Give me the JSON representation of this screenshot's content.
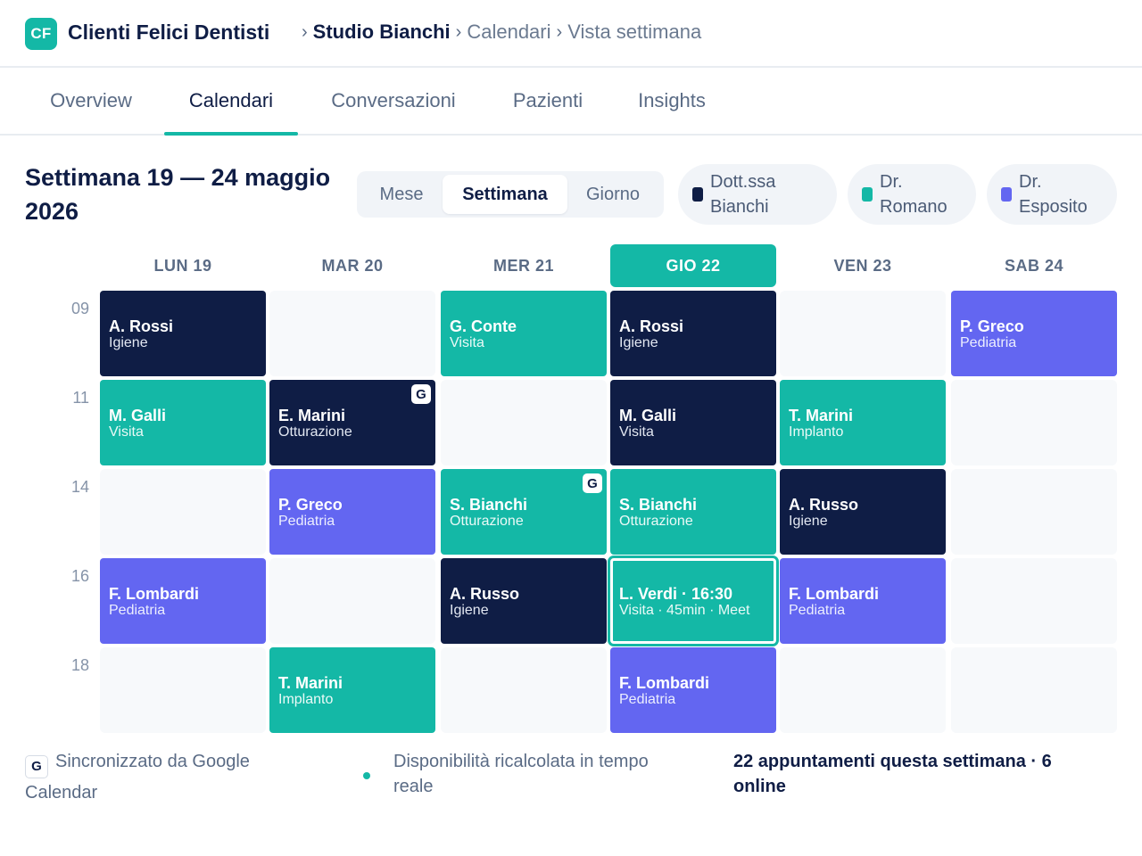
{
  "header": {
    "logo_text": "CF",
    "brand": "Clienti Felici Dentisti",
    "breadcrumb": [
      "Studio Bianchi",
      "Calendari",
      "Vista settimana"
    ]
  },
  "tabs": [
    "Overview",
    "Calendari",
    "Conversazioni",
    "Pazienti",
    "Insights"
  ],
  "active_tab": "Calendari",
  "toolbar": {
    "week_title": "Settimana 19 — 24 maggio 2026",
    "view_options": [
      "Mese",
      "Settimana",
      "Giorno"
    ],
    "active_view": "Settimana",
    "doctors": [
      {
        "label": "Dott.ssa Bianchi",
        "color": "#0f1d45"
      },
      {
        "label": "Dr. Romano",
        "color": "#14b8a6"
      },
      {
        "label": "Dr. Esposito",
        "color": "#6366f1"
      }
    ]
  },
  "calendar": {
    "days": [
      "LUN 19",
      "MAR 20",
      "MER 21",
      "GIO 22",
      "VEN 23",
      "SAB 24"
    ],
    "today": "GIO 22",
    "hours": [
      "09",
      "11",
      "14",
      "16",
      "18"
    ],
    "appointments": [
      [
        {
          "name": "A. Rossi",
          "type": "Igiene",
          "color": "navy"
        },
        null,
        {
          "name": "G. Conte",
          "type": "Visita",
          "color": "teal"
        },
        {
          "name": "A. Rossi",
          "type": "Igiene",
          "color": "navy"
        },
        null,
        {
          "name": "P. Greco",
          "type": "Pediatria",
          "color": "violet"
        }
      ],
      [
        {
          "name": "M. Galli",
          "type": "Visita",
          "color": "teal"
        },
        {
          "name": "E. Marini",
          "type": "Otturazione",
          "color": "navy",
          "google": "G"
        },
        null,
        {
          "name": "M. Galli",
          "type": "Visita",
          "color": "navy"
        },
        {
          "name": "T. Marini",
          "type": "Implanto",
          "color": "teal"
        },
        null
      ],
      [
        null,
        {
          "name": "P. Greco",
          "type": "Pediatria",
          "color": "violet"
        },
        {
          "name": "S. Bianchi",
          "type": "Otturazione",
          "color": "teal",
          "google": "G"
        },
        {
          "name": "S. Bianchi",
          "type": "Otturazione",
          "color": "teal"
        },
        {
          "name": "A. Russo",
          "type": "Igiene",
          "color": "navy"
        },
        null
      ],
      [
        {
          "name": "F. Lombardi",
          "type": "Pediatria",
          "color": "violet"
        },
        null,
        {
          "name": "A. Russo",
          "type": "Igiene",
          "color": "navy"
        },
        {
          "name": "L. Verdi · 16:30",
          "type": "Visita · 45min · Meet",
          "color": "teal",
          "selected": true
        },
        {
          "name": "F. Lombardi",
          "type": "Pediatria",
          "color": "violet"
        },
        null
      ],
      [
        null,
        {
          "name": "T. Marini",
          "type": "Implanto",
          "color": "teal"
        },
        null,
        {
          "name": "F. Lombardi",
          "type": "Pediatria",
          "color": "violet"
        },
        null,
        null
      ]
    ]
  },
  "footer": {
    "google_badge": "G",
    "sync_text": "Sincronizzato da Google Calendar",
    "realtime_text": "Disponibilità ricalcolata in tempo reale",
    "summary_text": "22 appuntamenti questa settimana · 6 online"
  }
}
